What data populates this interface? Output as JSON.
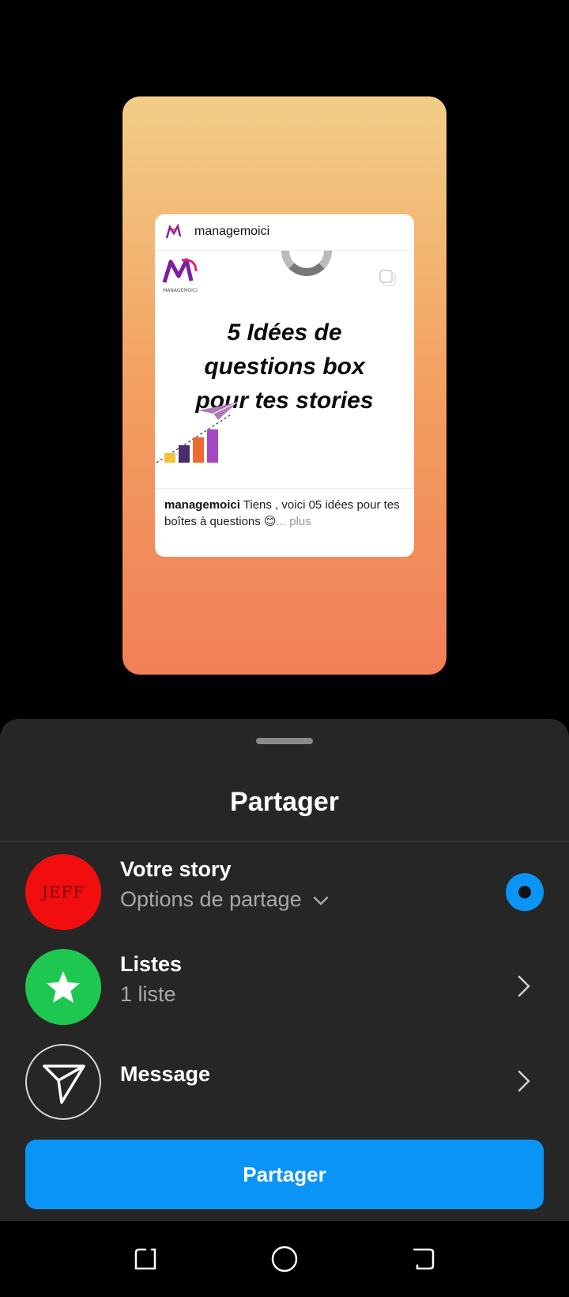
{
  "post": {
    "username": "managemoici",
    "headline_lines": [
      "5 Idées de",
      "questions box",
      "pour tes stories"
    ],
    "caption_user": "managemoici",
    "caption_text": " Tiens , voici 05 idées pour tes boîtes à questions 😊",
    "caption_more": "... plus",
    "logo_text": "MANAGEMOICI"
  },
  "sheet": {
    "title": "Partager",
    "rows": [
      {
        "title": "Votre story",
        "subtitle": "Options de partage",
        "avatar_text": "JEFF"
      },
      {
        "title": "Listes",
        "subtitle": "1 liste"
      },
      {
        "title": "Message"
      }
    ],
    "cta": "Partager"
  },
  "colors": {
    "accent": "#0a95f6",
    "sheet_bg": "#262626",
    "story_gradient": [
      "#f2ce88",
      "#f17f58"
    ],
    "list_green": "#1ec850",
    "avatar_red": "#f20e0e"
  },
  "icons": [
    "star-icon",
    "paper-plane-icon",
    "chevron-right-icon",
    "chevron-down-icon",
    "recents-icon",
    "home-icon",
    "back-icon"
  ]
}
